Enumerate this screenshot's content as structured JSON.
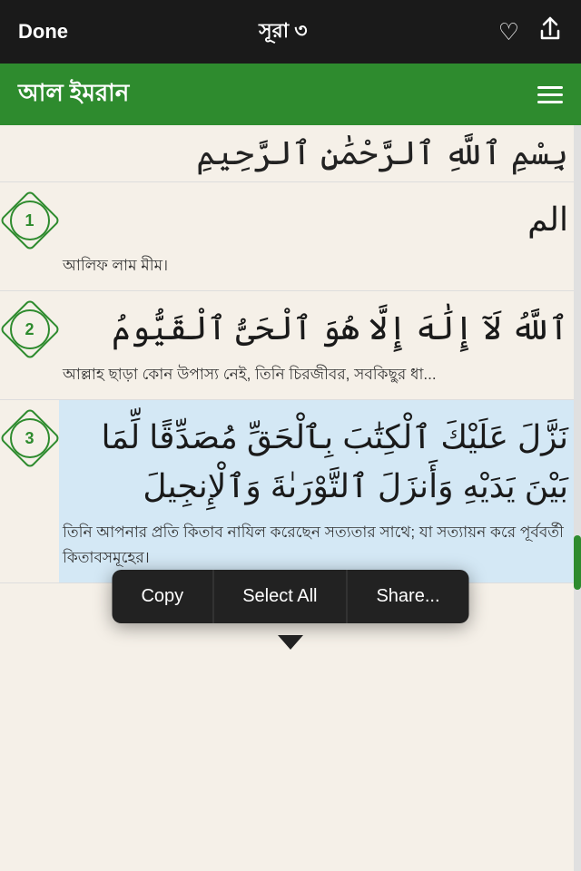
{
  "topNav": {
    "done_label": "Done",
    "title": "সূরা ৩",
    "heart_icon": "♡",
    "share_icon": "↑"
  },
  "greenHeader": {
    "surah_name": "আল ইমরান",
    "menu_icon": "☰"
  },
  "bismillah": {
    "text": "بِسْمِ ٱللَّهِ ٱلرَّحْمَٰنِ ٱلرَّحِيمِ"
  },
  "verses": [
    {
      "number": "1",
      "arabic": "الم",
      "bengali": "আলিফ লাম মীম।"
    },
    {
      "number": "2",
      "arabic": "ٱللَّهُ لَآ إِلَٰهَ إِلَّا هُوَ ٱلْحَىُّ ٱلْقَيُّومُ",
      "bengali": "আল্লাহ ছাড়া কোন উপাস্য নেই, তিনি চিরজীবর, সবকিছুর ধা..."
    },
    {
      "number": "3",
      "arabic": "نَزَّلَ عَلَيْكَ ٱلْكِتَٰبَ بِٱلْحَقِّ مُصَدِّقًا لِّمَا بَيْنَ يَدَيْهِ وَأَنزَلَ ٱلتَّوْرَىٰةَ وَٱلْإِنجِيلَ",
      "bengali": "তিনি আপনার প্রতি কিতাব নাযিল করেছেন সত্যতার সাথে; যা সত্যায়ন করে পূর্ববর্তী কিতাবসমূহের।",
      "selected": true
    }
  ],
  "contextMenu": {
    "copy_label": "Copy",
    "select_all_label": "Select All",
    "share_label": "Share..."
  }
}
